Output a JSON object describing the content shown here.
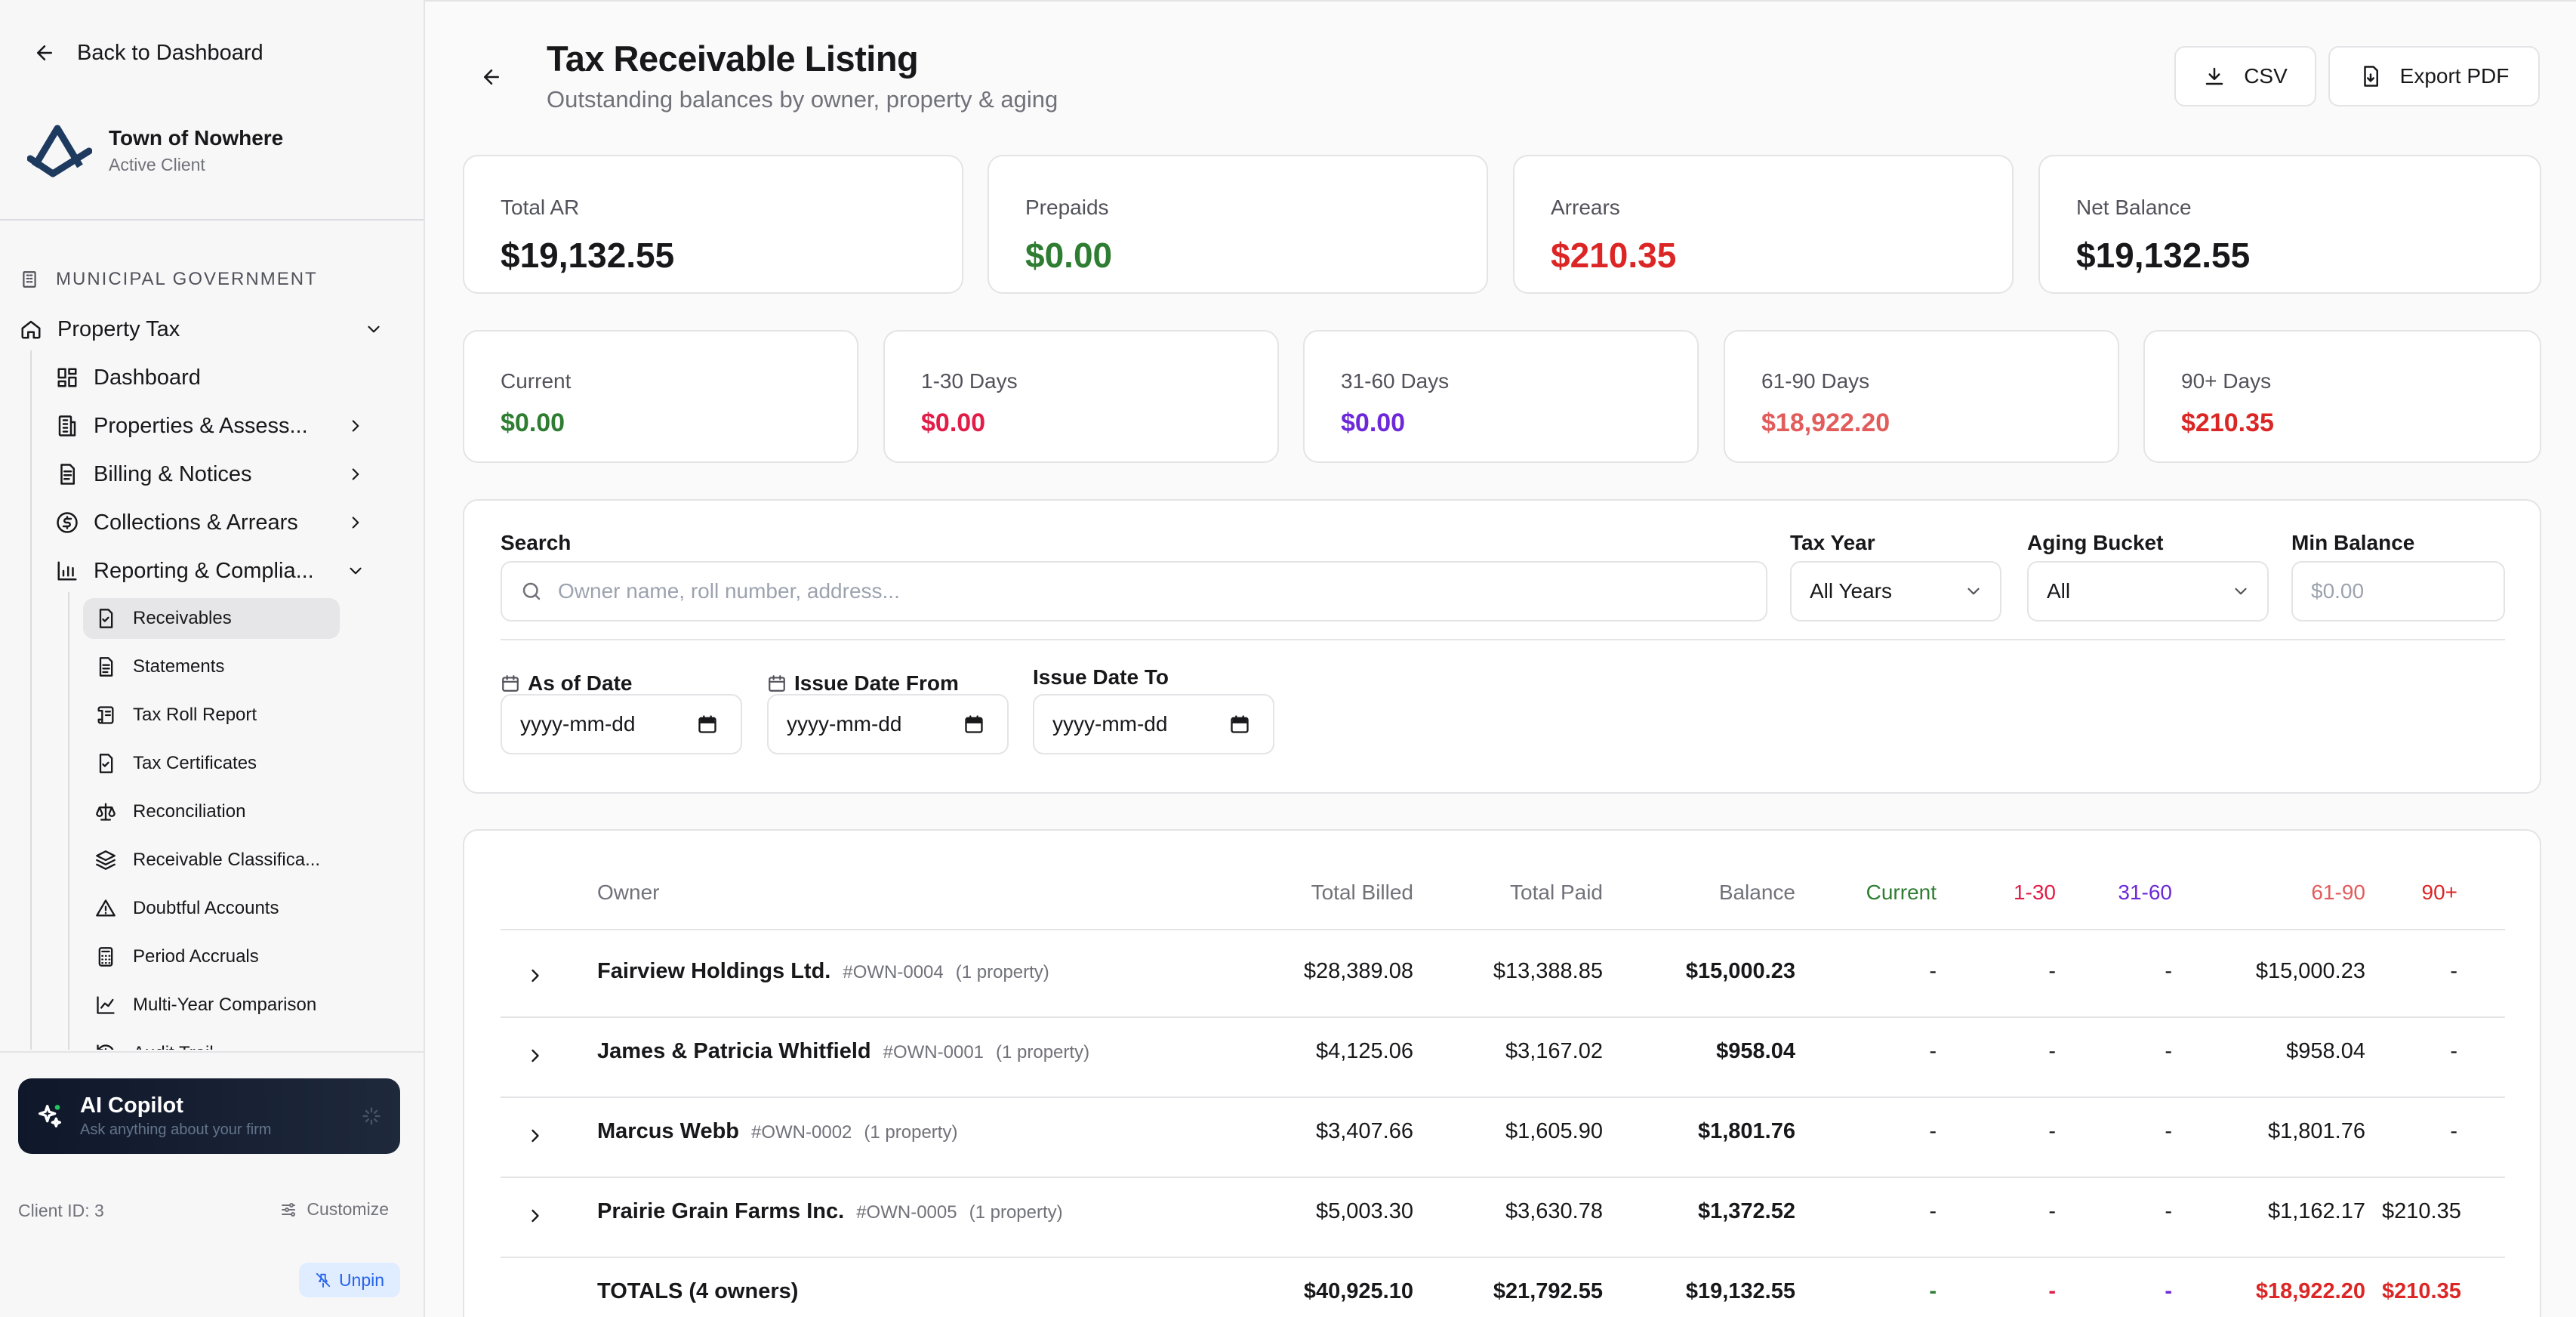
{
  "colors": {
    "green": "#2e7d32",
    "red": "#dc2626",
    "crimson": "#e11d48",
    "purple": "#6d28d9",
    "salmon": "#e25c5c",
    "accent_blue": "#2563eb",
    "copilot_bg": "#0f172a"
  },
  "sidebar": {
    "back_label": "Back to Dashboard",
    "client_name": "Town of Nowhere",
    "client_status": "Active Client",
    "section_label": "MUNICIPAL GOVERNMENT",
    "group": {
      "label": "Property Tax",
      "icon": "home-icon"
    },
    "items": [
      {
        "label": "Dashboard",
        "icon": "grid-icon"
      },
      {
        "label": "Properties & Assess...",
        "icon": "building-icon"
      },
      {
        "label": "Billing & Notices",
        "icon": "document-icon"
      },
      {
        "label": "Collections & Arrears",
        "icon": "dollar-circle-icon"
      },
      {
        "label": "Reporting & Complia...",
        "icon": "bar-chart-icon"
      }
    ],
    "sub_items": [
      {
        "label": "Receivables",
        "icon": "file-check-icon",
        "active": true
      },
      {
        "label": "Statements",
        "icon": "file-text-icon"
      },
      {
        "label": "Tax Roll Report",
        "icon": "scroll-icon"
      },
      {
        "label": "Tax Certificates",
        "icon": "file-check-icon"
      },
      {
        "label": "Reconciliation",
        "icon": "scale-icon"
      },
      {
        "label": "Receivable Classifica...",
        "icon": "layers-icon"
      },
      {
        "label": "Doubtful Accounts",
        "icon": "warning-icon"
      },
      {
        "label": "Period Accruals",
        "icon": "calculator-icon"
      },
      {
        "label": "Multi-Year Comparison",
        "icon": "line-chart-icon"
      },
      {
        "label": "Audit Trail",
        "icon": "history-icon"
      }
    ],
    "copilot": {
      "title": "AI Copilot",
      "subtitle": "Ask anything about your firm"
    },
    "client_id": "Client ID: 3",
    "customize_label": "Customize",
    "unpin_label": "Unpin"
  },
  "header": {
    "title": "Tax Receivable Listing",
    "subtitle": "Outstanding balances by owner, property & aging",
    "csv_label": "CSV",
    "pdf_label": "Export PDF"
  },
  "summary": [
    {
      "label": "Total AR",
      "value": "$19,132.55",
      "color": "#18181b"
    },
    {
      "label": "Prepaids",
      "value": "$0.00",
      "color": "#2e7d32"
    },
    {
      "label": "Arrears",
      "value": "$210.35",
      "color": "#dc2626"
    },
    {
      "label": "Net Balance",
      "value": "$19,132.55",
      "color": "#18181b"
    }
  ],
  "aging": [
    {
      "label": "Current",
      "value": "$0.00",
      "color": "#2e7d32"
    },
    {
      "label": "1-30 Days",
      "value": "$0.00",
      "color": "#e11d48"
    },
    {
      "label": "31-60 Days",
      "value": "$0.00",
      "color": "#6d28d9"
    },
    {
      "label": "61-90 Days",
      "value": "$18,922.20",
      "color": "#e25c5c"
    },
    {
      "label": "90+ Days",
      "value": "$210.35",
      "color": "#dc2626"
    }
  ],
  "filters": {
    "search_label": "Search",
    "search_placeholder": "Owner name, roll number, address...",
    "tax_year_label": "Tax Year",
    "tax_year_value": "All Years",
    "aging_label": "Aging Bucket",
    "aging_value": "All",
    "min_balance_label": "Min Balance",
    "min_balance_placeholder": "$0.00",
    "as_of_label": "As of Date",
    "issue_from_label": "Issue Date From",
    "issue_to_label": "Issue Date To",
    "date_placeholder": "yyyy-mm-dd"
  },
  "table": {
    "headers": {
      "owner": "Owner",
      "total_billed": "Total Billed",
      "total_paid": "Total Paid",
      "balance": "Balance",
      "current": "Current",
      "d1_30": "1-30",
      "d31_60": "31-60",
      "d61_90": "61-90",
      "d90": "90+"
    },
    "rows": [
      {
        "name": "Fairview Holdings Ltd.",
        "code": "#OWN-0004",
        "props": "(1 property)",
        "billed": "$28,389.08",
        "paid": "$13,388.85",
        "balance": "$15,000.23",
        "current": "-",
        "d1_30": "-",
        "d31_60": "-",
        "d61_90": "$15,000.23",
        "d90": "-"
      },
      {
        "name": "James & Patricia Whitfield",
        "code": "#OWN-0001",
        "props": "(1 property)",
        "billed": "$4,125.06",
        "paid": "$3,167.02",
        "balance": "$958.04",
        "current": "-",
        "d1_30": "-",
        "d31_60": "-",
        "d61_90": "$958.04",
        "d90": "-"
      },
      {
        "name": "Marcus Webb",
        "code": "#OWN-0002",
        "props": "(1 property)",
        "billed": "$3,407.66",
        "paid": "$1,605.90",
        "balance": "$1,801.76",
        "current": "-",
        "d1_30": "-",
        "d31_60": "-",
        "d61_90": "$1,801.76",
        "d90": "-"
      },
      {
        "name": "Prairie Grain Farms Inc.",
        "code": "#OWN-0005",
        "props": "(1 property)",
        "billed": "$5,003.30",
        "paid": "$3,630.78",
        "balance": "$1,372.52",
        "current": "-",
        "d1_30": "-",
        "d31_60": "-",
        "d61_90": "$1,162.17",
        "d90": "$210.35"
      }
    ],
    "totals": {
      "label": "TOTALS (4 owners)",
      "billed": "$40,925.10",
      "paid": "$21,792.55",
      "balance": "$19,132.55",
      "current": "-",
      "d1_30": "-",
      "d31_60": "-",
      "d61_90": "$18,922.20",
      "d90": "$210.35"
    }
  }
}
